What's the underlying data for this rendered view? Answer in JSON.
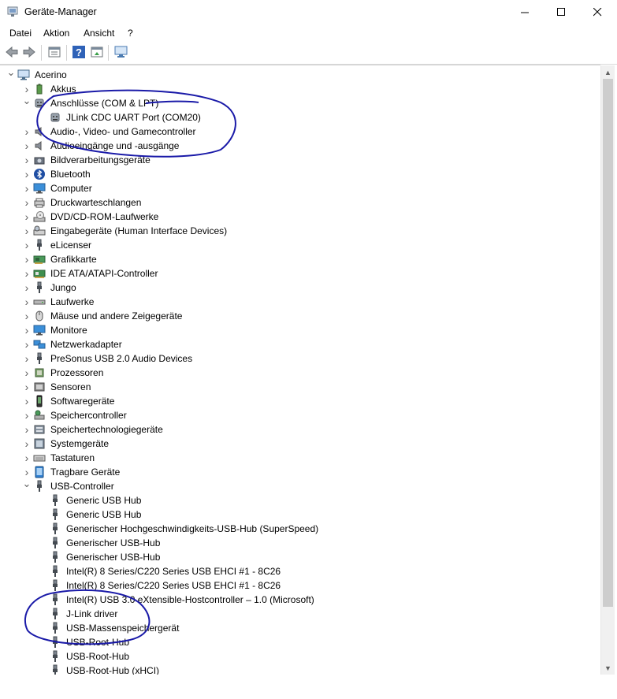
{
  "window": {
    "title": "Geräte-Manager",
    "controls": {
      "minimize": "—",
      "maximize": "☐",
      "close": "✕"
    }
  },
  "menu": [
    "Datei",
    "Aktion",
    "Ansicht",
    "?"
  ],
  "toolbar": [
    "back-icon",
    "forward-icon",
    "properties-icon",
    "help-icon",
    "update-icon",
    "monitor-icon"
  ],
  "tree": {
    "root": {
      "label": "Acerino",
      "icon": "computer-icon"
    },
    "categories": [
      {
        "label": "Akkus",
        "icon": "battery-icon",
        "expanded": false
      },
      {
        "label": "Anschlüsse (COM & LPT)",
        "icon": "port-icon",
        "expanded": true,
        "children": [
          {
            "label": "JLink CDC UART Port (COM20)",
            "icon": "port-icon"
          }
        ]
      },
      {
        "label": "Audio-, Video- und Gamecontroller",
        "icon": "speaker-icon",
        "expanded": false
      },
      {
        "label": "Audioeingänge und -ausgänge",
        "icon": "speaker-icon",
        "expanded": false
      },
      {
        "label": "Bildverarbeitungsgeräte",
        "icon": "camera-icon",
        "expanded": false
      },
      {
        "label": "Bluetooth",
        "icon": "bluetooth-icon",
        "expanded": false
      },
      {
        "label": "Computer",
        "icon": "monitor-icon",
        "expanded": false
      },
      {
        "label": "Druckwarteschlangen",
        "icon": "printer-icon",
        "expanded": false
      },
      {
        "label": "DVD/CD-ROM-Laufwerke",
        "icon": "disc-icon",
        "expanded": false
      },
      {
        "label": "Eingabegeräte (Human Interface Devices)",
        "icon": "hid-icon",
        "expanded": false
      },
      {
        "label": "eLicenser",
        "icon": "usb-plug-icon",
        "expanded": false
      },
      {
        "label": "Grafikkarte",
        "icon": "display-adapter-icon",
        "expanded": false
      },
      {
        "label": "IDE ATA/ATAPI-Controller",
        "icon": "ide-icon",
        "expanded": false
      },
      {
        "label": "Jungo",
        "icon": "usb-plug-icon",
        "expanded": false
      },
      {
        "label": "Laufwerke",
        "icon": "drive-icon",
        "expanded": false
      },
      {
        "label": "Mäuse und andere Zeigegeräte",
        "icon": "mouse-icon",
        "expanded": false
      },
      {
        "label": "Monitore",
        "icon": "monitor-icon",
        "expanded": false
      },
      {
        "label": "Netzwerkadapter",
        "icon": "network-icon",
        "expanded": false
      },
      {
        "label": "PreSonus USB 2.0 Audio Devices",
        "icon": "usb-plug-icon",
        "expanded": false
      },
      {
        "label": "Prozessoren",
        "icon": "cpu-icon",
        "expanded": false
      },
      {
        "label": "Sensoren",
        "icon": "sensor-icon",
        "expanded": false
      },
      {
        "label": "Softwaregeräte",
        "icon": "phone-icon",
        "expanded": false
      },
      {
        "label": "Speichercontroller",
        "icon": "storage-controller-icon",
        "expanded": false
      },
      {
        "label": "Speichertechnologiegeräte",
        "icon": "storage-tech-icon",
        "expanded": false
      },
      {
        "label": "Systemgeräte",
        "icon": "system-icon",
        "expanded": false
      },
      {
        "label": "Tastaturen",
        "icon": "keyboard-icon",
        "expanded": false
      },
      {
        "label": "Tragbare Geräte",
        "icon": "portable-icon",
        "expanded": false
      },
      {
        "label": "USB-Controller",
        "icon": "usb-plug-icon",
        "expanded": true,
        "children": [
          {
            "label": "Generic USB Hub",
            "icon": "usb-plug-icon"
          },
          {
            "label": "Generic USB Hub",
            "icon": "usb-plug-icon"
          },
          {
            "label": "Generischer Hochgeschwindigkeits-USB-Hub (SuperSpeed)",
            "icon": "usb-plug-icon"
          },
          {
            "label": "Generischer USB-Hub",
            "icon": "usb-plug-icon"
          },
          {
            "label": "Generischer USB-Hub",
            "icon": "usb-plug-icon"
          },
          {
            "label": "Intel(R) 8 Series/C220 Series USB EHCI #1 - 8C26",
            "icon": "usb-plug-icon"
          },
          {
            "label": "Intel(R) 8 Series/C220 Series USB EHCI #1 - 8C26",
            "icon": "usb-plug-icon"
          },
          {
            "label": "Intel(R) USB 3.0 eXtensible-Hostcontroller – 1.0 (Microsoft)",
            "icon": "usb-plug-icon"
          },
          {
            "label": "J-Link driver",
            "icon": "usb-plug-icon"
          },
          {
            "label": "USB-Massenspeichergerät",
            "icon": "usb-plug-icon"
          },
          {
            "label": "USB-Root-Hub",
            "icon": "usb-plug-icon"
          },
          {
            "label": "USB-Root-Hub",
            "icon": "usb-plug-icon"
          },
          {
            "label": "USB-Root-Hub (xHCI)",
            "icon": "usb-plug-icon"
          }
        ]
      }
    ]
  },
  "annotations": {
    "pen_color": "#1a1aa8"
  }
}
